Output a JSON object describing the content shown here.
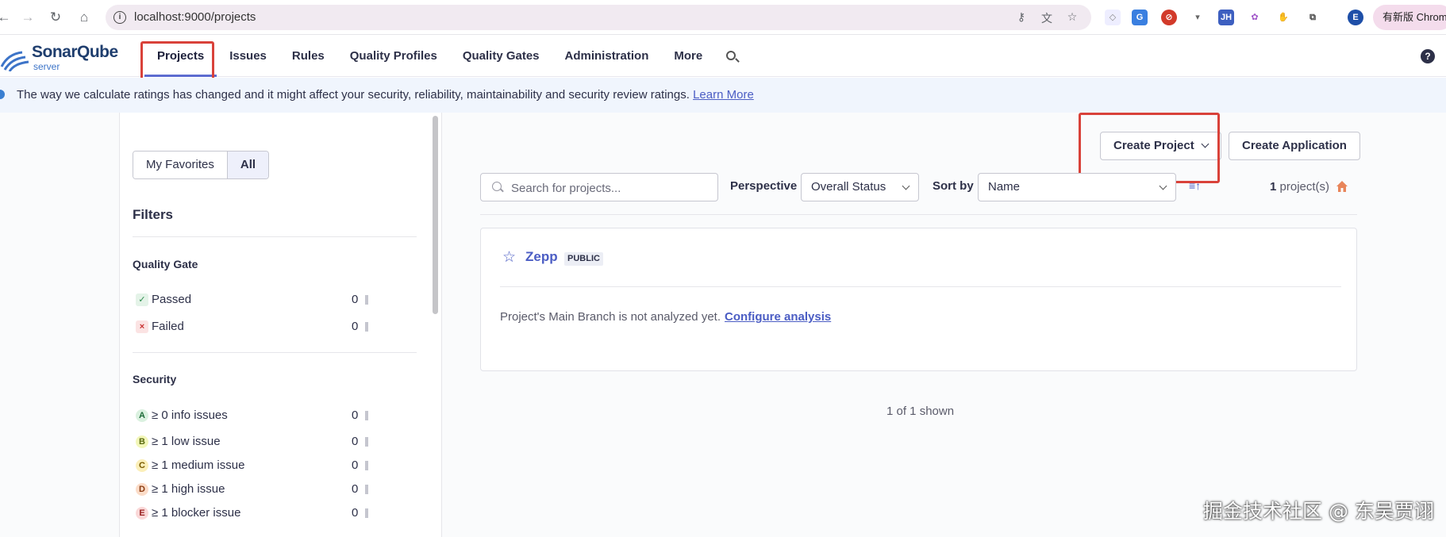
{
  "browser": {
    "url": "localhost:9000/projects",
    "profile_label": "有新版 Chrome"
  },
  "header": {
    "brand": "SonarQube",
    "brand_sub": "server",
    "nav": [
      {
        "label": "Projects",
        "active": true
      },
      {
        "label": "Issues"
      },
      {
        "label": "Rules"
      },
      {
        "label": "Quality Profiles"
      },
      {
        "label": "Quality Gates"
      },
      {
        "label": "Administration"
      },
      {
        "label": "More"
      }
    ],
    "help": "?"
  },
  "banner": {
    "text": "The way we calculate ratings has changed and it might affect your security, reliability, maintainability and security review ratings.",
    "link": "Learn More"
  },
  "sidebar": {
    "toggle": [
      "My Favorites",
      "All"
    ],
    "filters_title": "Filters",
    "quality_gate": {
      "title": "Quality Gate",
      "items": [
        {
          "label": "Passed",
          "count": "0"
        },
        {
          "label": "Failed",
          "count": "0"
        }
      ]
    },
    "security": {
      "title": "Security",
      "items": [
        {
          "grade": "A",
          "label": "≥ 0 info issues",
          "count": "0"
        },
        {
          "grade": "B",
          "label": "≥ 1 low issue",
          "count": "0"
        },
        {
          "grade": "C",
          "label": "≥ 1 medium issue",
          "count": "0"
        },
        {
          "grade": "D",
          "label": "≥ 1 high issue",
          "count": "0"
        },
        {
          "grade": "E",
          "label": "≥ 1 blocker issue",
          "count": "0"
        }
      ]
    }
  },
  "main": {
    "create_project": "Create Project",
    "create_application": "Create Application",
    "search_placeholder": "Search for projects...",
    "perspective_label": "Perspective",
    "perspective_value": "Overall Status",
    "sort_label": "Sort by",
    "sort_value": "Name",
    "count_num": "1",
    "count_suffix": "project(s)",
    "project": {
      "name": "Zepp",
      "visibility": "PUBLIC",
      "message": "Project's Main Branch is not analyzed yet.",
      "link": "Configure analysis"
    },
    "shown": "1 of 1 shown"
  },
  "watermark": "掘金技术社区 @ 东吴贾诩",
  "colors": {
    "accent": "#4b5dc4",
    "highlight": "#d9423a"
  }
}
